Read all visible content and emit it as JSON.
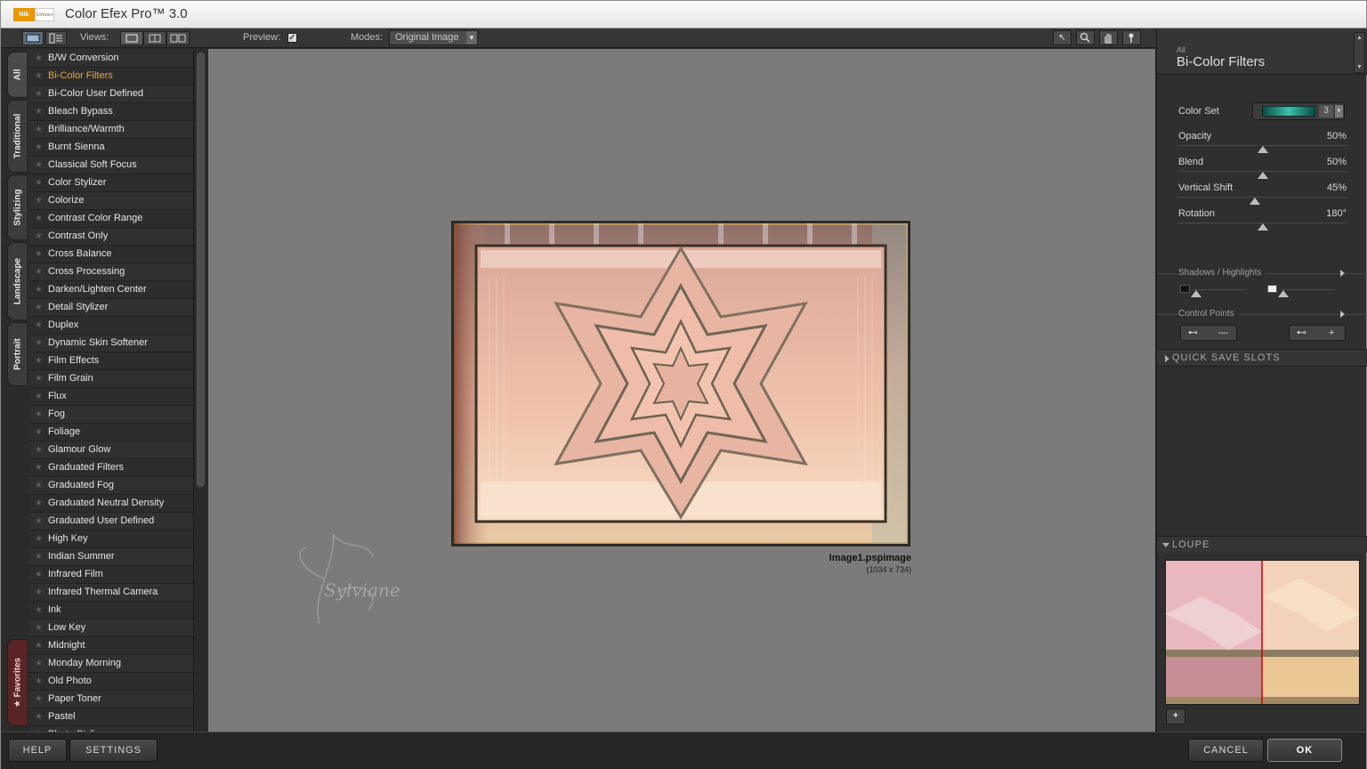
{
  "app": {
    "logo_main": "Nik",
    "logo_sub": "Software",
    "title": "Color Efex Pro™ 3.0"
  },
  "toolbar": {
    "views_label": "Views:",
    "preview_label": "Preview:",
    "preview_checked": "✓",
    "modes_label": "Modes:",
    "modes_value": "Original Image"
  },
  "tabs": [
    "All",
    "Traditional",
    "Stylizing",
    "Landscape",
    "Portrait"
  ],
  "favorites_tab": "Favorites",
  "filters": [
    "B/W Conversion",
    "Bi-Color Filters",
    "Bi-Color User Defined",
    "Bleach Bypass",
    "Brilliance/Warmth",
    "Burnt Sienna",
    "Classical Soft Focus",
    "Color Stylizer",
    "Colorize",
    "Contrast Color Range",
    "Contrast Only",
    "Cross Balance",
    "Cross Processing",
    "Darken/Lighten Center",
    "Detail Stylizer",
    "Duplex",
    "Dynamic Skin Softener",
    "Film Effects",
    "Film Grain",
    "Flux",
    "Fog",
    "Foliage",
    "Glamour Glow",
    "Graduated Filters",
    "Graduated Fog",
    "Graduated Neutral Density",
    "Graduated User Defined",
    "High Key",
    "Indian Summer",
    "Infrared Film",
    "Infrared Thermal Camera",
    "Ink",
    "Low Key",
    "Midnight",
    "Monday Morning",
    "Old Photo",
    "Paper Toner",
    "Pastel",
    "Photo Stylizer"
  ],
  "active_filter_index": 1,
  "preview": {
    "filename": "Image1.pspimage",
    "dimensions": "(1034 x 734)",
    "watermark_text": "Sylviane"
  },
  "panel": {
    "category": "All",
    "filter_name": "Bi-Color Filters",
    "color_set_label": "Color Set",
    "color_set_value": "3",
    "sliders": [
      {
        "label": "Opacity",
        "value": "50%",
        "fraction": 0.5
      },
      {
        "label": "Blend",
        "value": "50%",
        "fraction": 0.5
      },
      {
        "label": "Vertical Shift",
        "value": "45%",
        "fraction": 0.45
      },
      {
        "label": "Rotation",
        "value": "180°",
        "fraction": 0.5
      }
    ],
    "shadows_highlights": "Shadows / Highlights",
    "control_points": "Control Points",
    "cp_minus": "—",
    "cp_plus": "+",
    "quick_save": "QUICK SAVE SLOTS",
    "loupe": "LOUPE"
  },
  "buttons": {
    "help": "HELP",
    "settings": "SETTINGS",
    "cancel": "CANCEL",
    "ok": "OK"
  }
}
